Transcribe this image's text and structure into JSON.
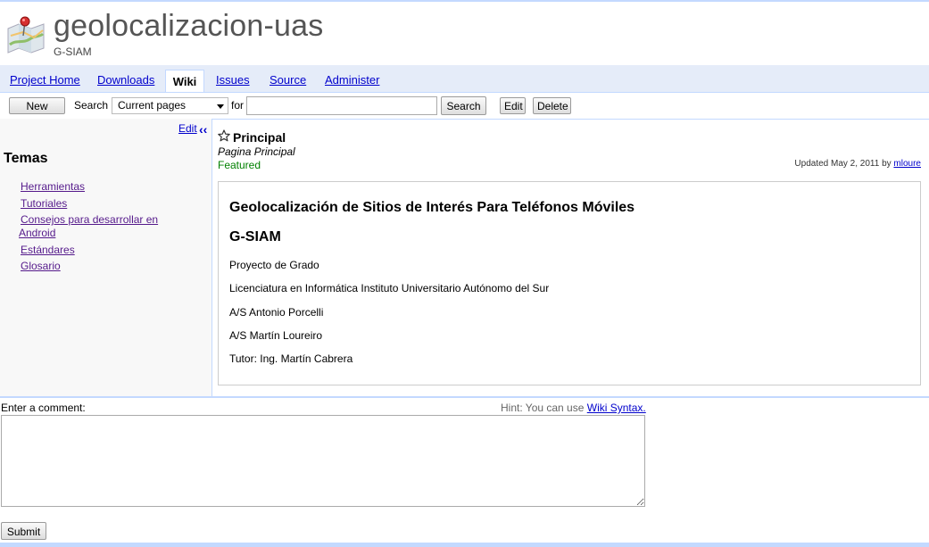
{
  "project": {
    "title": "geolocalizacion-uas",
    "summary": "G-SIAM"
  },
  "tabs": {
    "project_home": "Project Home",
    "downloads": "Downloads",
    "wiki": "Wiki",
    "issues": "Issues",
    "source": "Source",
    "administer": "Administer",
    "active": "Wiki"
  },
  "toolbar": {
    "new_page": "New page",
    "search_label": "Search",
    "search_scope": "Current pages",
    "for_label": "for",
    "search_query": "",
    "search_button": "Search",
    "edit_button": "Edit",
    "delete_button": "Delete"
  },
  "sidebar": {
    "edit_link": "Edit",
    "collapse": "‹‹",
    "heading": "Temas",
    "items": [
      {
        "label": "Herramientas"
      },
      {
        "label": "Tutoriales"
      },
      {
        "label": "Consejos para desarrollar en"
      },
      {
        "label": "Android"
      },
      {
        "label": "Estándares"
      },
      {
        "label": "Glosario"
      }
    ]
  },
  "page": {
    "title": "Principal",
    "summary": "Pagina Principal",
    "label": "Featured",
    "updated_prefix": "Updated May 2, 2011 by",
    "updated_by": "mloure",
    "content": {
      "heading1": "Geolocalización de Sitios de Interés Para Teléfonos Móviles",
      "heading2": "G-SIAM",
      "paragraphs": [
        "Proyecto de Grado",
        "Licenciatura en Informática Instituto Universitario Autónomo del Sur",
        "A/S Antonio Porcelli",
        "A/S Martín Loureiro",
        "Tutor: Ing. Martín Cabrera"
      ]
    }
  },
  "comment": {
    "label": "Enter a comment:",
    "hint_prefix": "Hint: You can use",
    "hint_link": "Wiki Syntax.",
    "value": "",
    "submit": "Submit"
  }
}
